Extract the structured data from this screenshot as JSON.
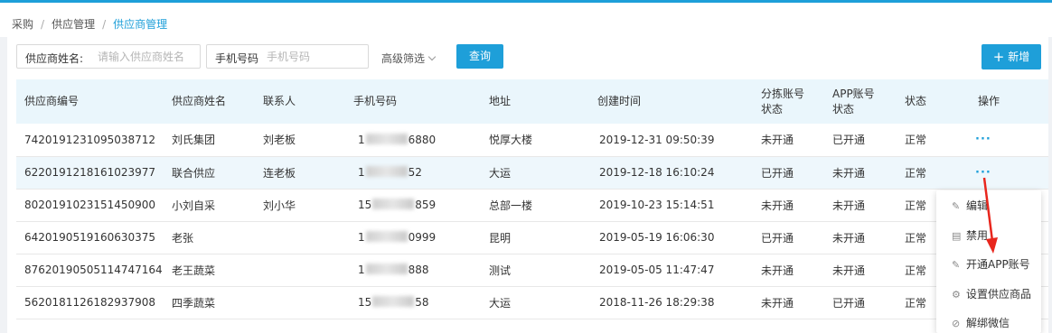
{
  "breadcrumb": {
    "items": [
      "采购",
      "供应管理",
      "供应商管理"
    ]
  },
  "filters": {
    "supplier_name_label": "供应商姓名:",
    "supplier_name_placeholder": "请输入供应商姓名",
    "phone_label": "手机号码",
    "phone_placeholder": "手机号码",
    "advanced_label": "高级筛选",
    "query_label": "查询"
  },
  "toolbar": {
    "add_label": "新增"
  },
  "table": {
    "columns": [
      "供应商编号",
      "供应商姓名",
      "联系人",
      "手机号码",
      "地址",
      "创建时间",
      "分拣账号状态",
      "APP账号状态",
      "状态",
      "操作"
    ],
    "rows": [
      {
        "id": "7420191231095038712",
        "name": "刘氏集团",
        "contact": "刘老板",
        "phone_prefix": "1",
        "phone_suffix": "6880",
        "address": "悦厚大楼",
        "created": "2019-12-31 09:50:39",
        "sort_status": "未开通",
        "app_status": "已开通",
        "status": "正常",
        "action": "···"
      },
      {
        "id": "6220191218161023977",
        "name": "联合供应",
        "contact": "连老板",
        "phone_prefix": "1",
        "phone_suffix": "52",
        "address": "大运",
        "created": "2019-12-18 16:10:24",
        "sort_status": "已开通",
        "app_status": "未开通",
        "status": "正常",
        "action": "···"
      },
      {
        "id": "8020191023151450900",
        "name": "小刘自采",
        "contact": "刘小华",
        "phone_prefix": "15",
        "phone_suffix": "859",
        "address": "总部一楼",
        "created": "2019-10-23 15:14:51",
        "sort_status": "未开通",
        "app_status": "未开通",
        "status": "正常",
        "action": ""
      },
      {
        "id": "6420190519160630375",
        "name": "老张",
        "contact": "",
        "phone_prefix": "1",
        "phone_suffix": "0999",
        "address": "昆明",
        "created": "2019-05-19 16:06:30",
        "sort_status": "已开通",
        "app_status": "未开通",
        "status": "正常",
        "action": ""
      },
      {
        "id": "8762019050511474716​4",
        "name": "老王蔬菜",
        "contact": "",
        "phone_prefix": "1",
        "phone_suffix": "888",
        "address": "测试",
        "created": "2019-05-05 11:47:47",
        "sort_status": "未开通",
        "app_status": "未开通",
        "status": "正常",
        "action": ""
      },
      {
        "id": "5620181126182937908",
        "name": "四季蔬菜",
        "contact": "",
        "phone_prefix": "15",
        "phone_suffix": "58",
        "address": "大运",
        "created": "2018-11-26 18:29:38",
        "sort_status": "未开通",
        "app_status": "已开通",
        "status": "正常",
        "action": ""
      }
    ]
  },
  "action_menu": {
    "items": [
      {
        "label": "编辑",
        "icon": "edit-icon"
      },
      {
        "label": "禁用",
        "icon": "disable-icon"
      },
      {
        "label": "开通APP账号",
        "icon": "open-account-icon"
      },
      {
        "label": "设置供应商品",
        "icon": "settings-icon"
      },
      {
        "label": "解绑微信",
        "icon": "unbind-icon"
      }
    ]
  },
  "colors": {
    "accent": "#1e9fd9",
    "header_bg": "#eaf6fc",
    "arrow": "#e8261d"
  }
}
